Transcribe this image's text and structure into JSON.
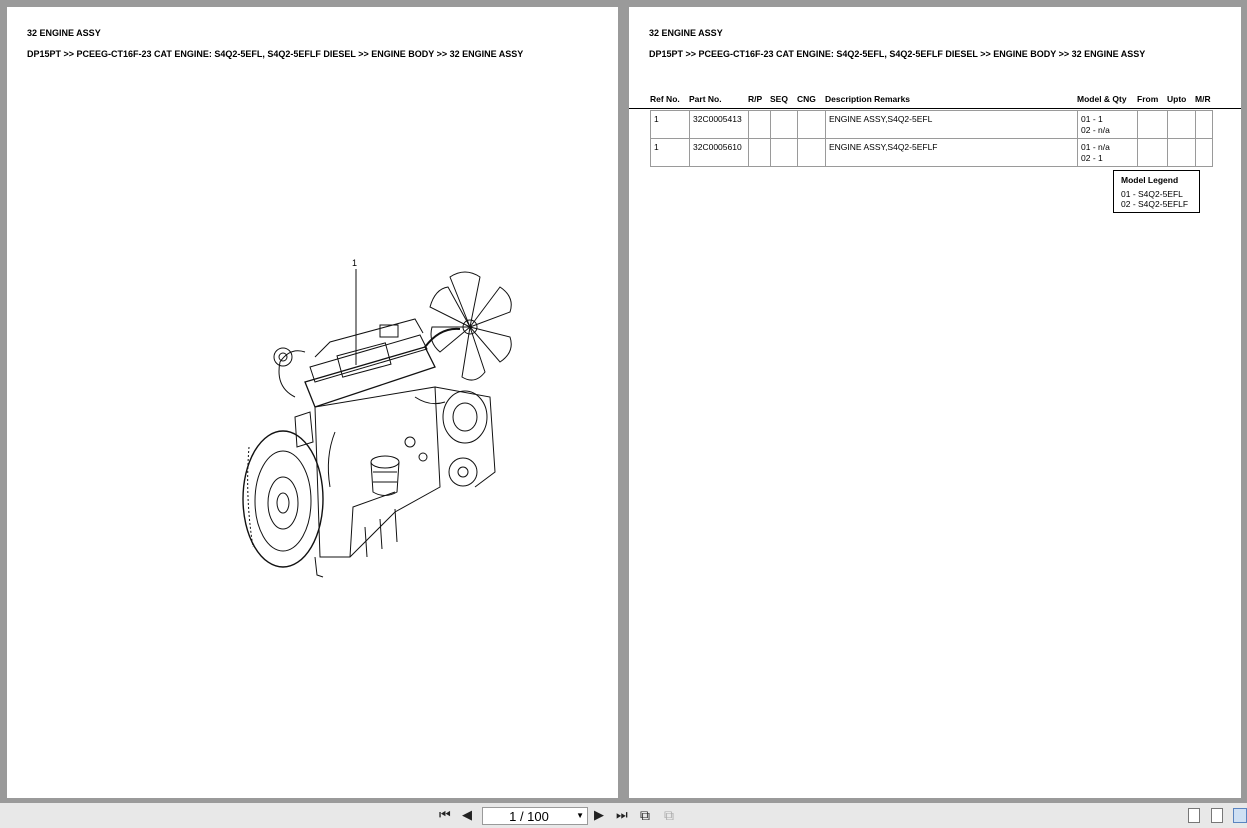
{
  "left_page": {
    "title": "32 ENGINE ASSY",
    "breadcrumb": "DP15PT >> PCEEG-CT16F-23 CAT ENGINE: S4Q2-5EFL, S4Q2-5EFLF DIESEL >> ENGINE BODY >> 32 ENGINE ASSY",
    "callout": "1",
    "illustration": "engine-assembly-drawing"
  },
  "right_page": {
    "title": "32 ENGINE ASSY",
    "breadcrumb": "DP15PT >> PCEEG-CT16F-23 CAT ENGINE: S4Q2-5EFL, S4Q2-5EFLF DIESEL >> ENGINE BODY >> 32 ENGINE ASSY",
    "columns": {
      "ref": "Ref No.",
      "part": "Part No.",
      "rp": "R/P",
      "seq": "SEQ",
      "cng": "CNG",
      "desc": "Description Remarks",
      "model": "Model & Qty",
      "from": "From",
      "upto": "Upto",
      "mr": "M/R"
    },
    "rows": [
      {
        "ref": "1",
        "part": "32C0005413",
        "rp": "",
        "seq": "",
        "cng": "",
        "desc": "ENGINE ASSY,S4Q2-5EFL",
        "model_1": "01 - 1",
        "model_2": "02 - n/a",
        "from": "",
        "upto": "",
        "mr": ""
      },
      {
        "ref": "1",
        "part": "32C0005610",
        "rp": "",
        "seq": "",
        "cng": "",
        "desc": "ENGINE ASSY,S4Q2-5EFLF",
        "model_1": "01 - n/a",
        "model_2": "02 - 1",
        "from": "",
        "upto": "",
        "mr": ""
      }
    ],
    "legend": {
      "title": "Model Legend",
      "items": [
        "01 - S4Q2-5EFL",
        "02 - S4Q2-5EFLF"
      ]
    }
  },
  "toolbar": {
    "first_page_icon": "first-page-icon",
    "prev_page_icon": "prev-page-icon",
    "page_indicator": "1 / 100",
    "next_page_icon": "next-page-icon",
    "last_page_icon": "last-page-icon",
    "view_modes": [
      "single-page-view",
      "continuous-view",
      "two-page-view"
    ],
    "active_view": "two-page-view"
  }
}
